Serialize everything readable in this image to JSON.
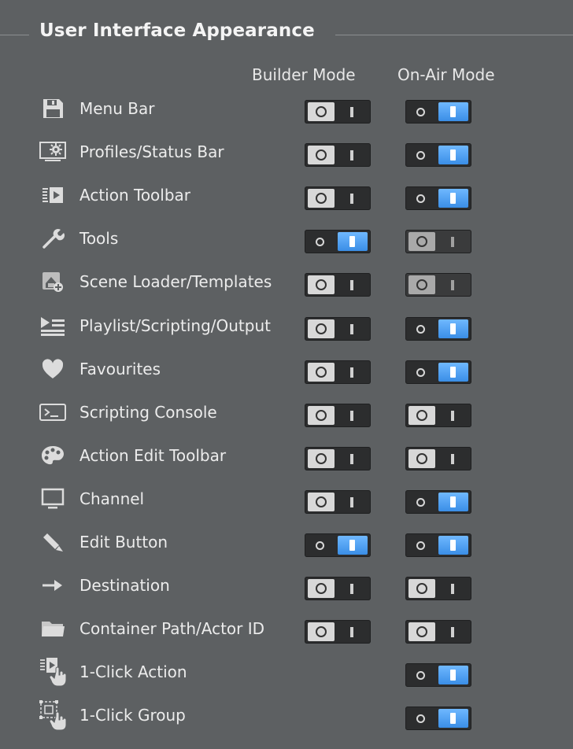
{
  "section": {
    "title": "User Interface Appearance"
  },
  "columns": {
    "builder": "Builder Mode",
    "onair": "On-Air Mode"
  },
  "rows": [
    {
      "label": "Menu Bar",
      "icon": "save-icon",
      "builder": "off",
      "onair": "on"
    },
    {
      "label": "Profiles/Status Bar",
      "icon": "monitor-settings-icon",
      "builder": "off",
      "onair": "on"
    },
    {
      "label": "Action Toolbar",
      "icon": "action-toolbar-icon",
      "builder": "off",
      "onair": "on"
    },
    {
      "label": "Tools",
      "icon": "wrench-icon",
      "builder": "on",
      "onair": "off-disabled"
    },
    {
      "label": "Scene Loader/Templates",
      "icon": "scene-loader-icon",
      "builder": "off",
      "onair": "off-disabled"
    },
    {
      "label": "Playlist/Scripting/Output",
      "icon": "playlist-icon",
      "builder": "off",
      "onair": "on"
    },
    {
      "label": "Favourites",
      "icon": "heart-icon",
      "builder": "off",
      "onair": "on"
    },
    {
      "label": "Scripting Console",
      "icon": "console-icon",
      "builder": "off",
      "onair": "off"
    },
    {
      "label": "Action Edit Toolbar",
      "icon": "palette-icon",
      "builder": "off",
      "onair": "off"
    },
    {
      "label": "Channel",
      "icon": "monitor-icon",
      "builder": "off",
      "onair": "on"
    },
    {
      "label": "Edit Button",
      "icon": "pencil-icon",
      "builder": "on",
      "onair": "on"
    },
    {
      "label": "Destination",
      "icon": "arrow-right-icon",
      "builder": "off",
      "onair": "off"
    },
    {
      "label": "Container Path/Actor ID",
      "icon": "folder-icon",
      "builder": "off",
      "onair": "off"
    },
    {
      "label": "1-Click Action",
      "icon": "one-click-action-icon",
      "builder": null,
      "onair": "on"
    },
    {
      "label": "1-Click Group",
      "icon": "one-click-group-icon",
      "builder": null,
      "onair": "on"
    }
  ]
}
